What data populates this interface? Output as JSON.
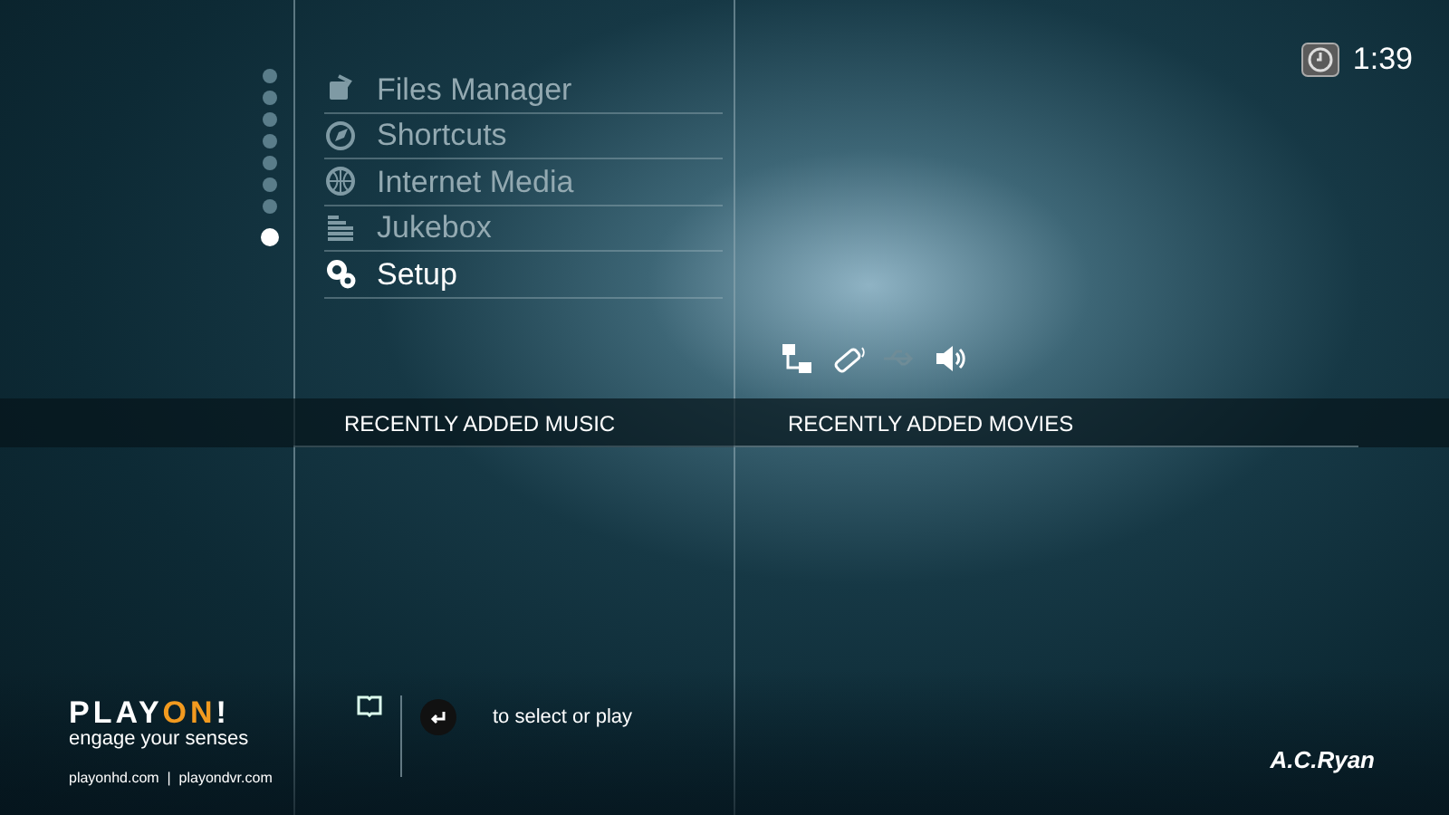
{
  "clock": {
    "time": "1:39"
  },
  "page_dots": [
    {
      "selected": false
    },
    {
      "selected": false
    },
    {
      "selected": false
    },
    {
      "selected": false
    },
    {
      "selected": false
    },
    {
      "selected": false
    },
    {
      "selected": false
    },
    {
      "selected": true
    }
  ],
  "menu": [
    {
      "kind": "files",
      "label": "Files Manager",
      "selected": false
    },
    {
      "kind": "shortcuts",
      "label": "Shortcuts",
      "selected": false
    },
    {
      "kind": "internet",
      "label": "Internet Media",
      "selected": false
    },
    {
      "kind": "jukebox",
      "label": "Jukebox",
      "selected": false
    },
    {
      "kind": "setup",
      "label": "Setup",
      "selected": true
    }
  ],
  "status_icons": [
    {
      "kind": "network",
      "active": true
    },
    {
      "kind": "remote",
      "active": true
    },
    {
      "kind": "usb",
      "active": false
    },
    {
      "kind": "speaker",
      "active": true
    }
  ],
  "sections": [
    {
      "title": "RECENTLY ADDED MUSIC"
    },
    {
      "title": "RECENTLY ADDED MOVIES"
    }
  ],
  "brand": {
    "logo": [
      {
        "text": "PLAY",
        "highlight": false
      },
      {
        "text": "ON",
        "highlight": true
      },
      {
        "text": "!",
        "highlight": false
      }
    ],
    "tagline": "engage your senses",
    "sites": "playonhd.com  |  playondvr.com"
  },
  "hint": {
    "text": "to select or play"
  },
  "maker": "A.C.Ryan"
}
